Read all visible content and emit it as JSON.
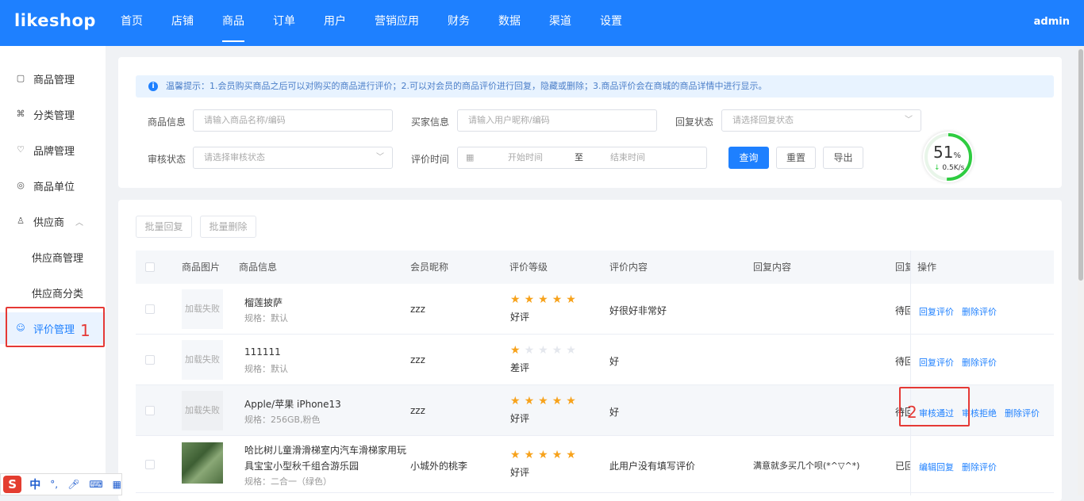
{
  "header": {
    "logo": "likeshop",
    "nav": [
      "首页",
      "店铺",
      "商品",
      "订单",
      "用户",
      "营销应用",
      "财务",
      "数据",
      "渠道",
      "设置"
    ],
    "active_nav": "商品",
    "user": "admin"
  },
  "sidebar": {
    "items": [
      {
        "label": "商品管理",
        "icon": "product-icon"
      },
      {
        "label": "分类管理",
        "icon": "category-icon"
      },
      {
        "label": "品牌管理",
        "icon": "brand-icon"
      },
      {
        "label": "商品单位",
        "icon": "unit-icon"
      },
      {
        "label": "供应商",
        "icon": "supplier-icon"
      },
      {
        "label": "供应商管理"
      },
      {
        "label": "供应商分类"
      },
      {
        "label": "评价管理",
        "icon": "comment-icon"
      }
    ],
    "active": "评价管理"
  },
  "annotations": {
    "one": "1",
    "two": "2"
  },
  "tip": "温馨提示：1.会员购买商品之后可以对购买的商品进行评价；2.可以对会员的商品评价进行回复，隐藏或删除；3.商品评价会在商城的商品详情中进行显示。",
  "filters": {
    "goods_label": "商品信息",
    "goods_ph": "请输入商品名称/编码",
    "buyer_label": "买家信息",
    "buyer_ph": "请输入用户昵称/编码",
    "reply_label": "回复状态",
    "reply_ph": "请选择回复状态",
    "audit_label": "审核状态",
    "audit_ph": "请选择审核状态",
    "time_label": "评价时间",
    "start_ph": "开始时间",
    "to": "至",
    "end_ph": "结束时间",
    "query": "查询",
    "reset": "重置",
    "export": "导出"
  },
  "gauge": {
    "percent": "51",
    "unit": "%",
    "speed": "0.5K/s",
    "value": 0.51
  },
  "batch": {
    "reply": "批量回复",
    "delete": "批量删除"
  },
  "table": {
    "headers": [
      "商品图片",
      "商品信息",
      "会员昵称",
      "评价等级",
      "评价内容",
      "回复内容",
      "回复",
      "操作"
    ],
    "rows": [
      {
        "img": "加载失败",
        "name": "榴莲披萨",
        "name2": "",
        "spec": "规格：默认",
        "member": "zzz",
        "stars": 5,
        "level": "好评",
        "content": "好很好非常好",
        "reply": "",
        "status": "待回",
        "actions": [
          "回复评价",
          "删除评价"
        ]
      },
      {
        "img": "加载失败",
        "name": "111111",
        "name2": "",
        "spec": "规格：默认",
        "member": "zzz",
        "stars": 1,
        "level": "差评",
        "content": "好",
        "reply": "",
        "status": "待回",
        "actions": [
          "回复评价",
          "删除评价"
        ]
      },
      {
        "img": "加载失败",
        "name": "Apple/苹果 iPhone13",
        "name2": "",
        "spec": "规格：256GB,粉色",
        "member": "zzz",
        "stars": 5,
        "level": "好评",
        "content": "好",
        "reply": "",
        "status": "待回",
        "actions": [
          "审核通过",
          "审核拒绝",
          "删除评价"
        ]
      },
      {
        "img": "",
        "name": "哈比树儿童滑滑梯室内汽车滑梯家用玩",
        "name2": "具宝宝小型秋千组合游乐园",
        "spec": "规格：二合一（绿色）",
        "member": "小城外的桃李",
        "stars": 5,
        "level": "好评",
        "content": "此用户没有填写评价",
        "reply": "满意就多买几个呗(*^▽^*)",
        "status": "已回",
        "actions": [
          "编辑回复",
          "删除评价"
        ]
      }
    ]
  },
  "ime": {
    "logo": "S",
    "lang": "中",
    "punct": "°,",
    "mic": "mic-icon",
    "kbd": "keyboard-icon",
    "grid": "apps-icon"
  }
}
